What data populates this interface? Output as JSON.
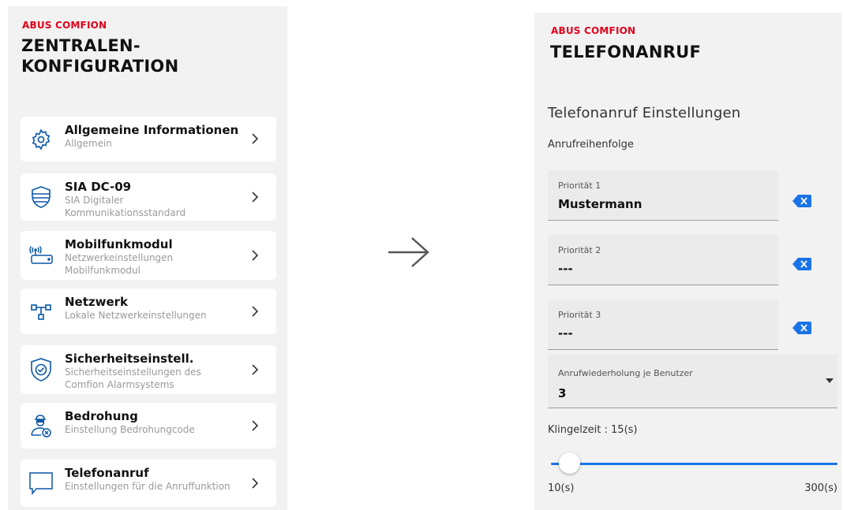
{
  "left_screen": {
    "brand": "ABUS COMFION",
    "title": "ZENTRALEN-\nKONFIGURATION",
    "items": [
      {
        "title": "Allgemeine Informationen",
        "subtitle": "Allgemein",
        "icon": "gear-icon"
      },
      {
        "title": "SIA DC-09",
        "subtitle": "SIA Digitaler Kommunikationsstandard",
        "icon": "shield-icon"
      },
      {
        "title": "Mobilfunkmodul",
        "subtitle": "Netzwerkeinstellungen Mobilfunkmodul",
        "icon": "cellular-module-icon"
      },
      {
        "title": "Netzwerk",
        "subtitle": "Lokale Netzwerkeinstellungen",
        "icon": "network-icon"
      },
      {
        "title": "Sicherheitseinstell.",
        "subtitle": "Sicherheitseinstellungen des Comfion Alarmsystems",
        "icon": "shield-check-icon"
      },
      {
        "title": "Bedrohung",
        "subtitle": "Einstellung Bedrohungcode",
        "icon": "threat-user-icon"
      },
      {
        "title": "Telefonanruf",
        "subtitle": "Einstellungen für die Anruffunktion",
        "icon": "chat-bubble-icon"
      }
    ]
  },
  "arrow_icon": "arrow-right-icon",
  "right_screen": {
    "brand": "ABUS COMFION",
    "title": "TELEFONANRUF",
    "section_heading": "Telefonanruf Einstellungen",
    "subheading": "Anrufreihenfolge",
    "priorities": [
      {
        "label": "Priorität 1",
        "value": "Mustermann"
      },
      {
        "label": "Priorität 2",
        "value": "---"
      },
      {
        "label": "Priorität 3",
        "value": "---"
      }
    ],
    "repeat": {
      "label": "Anrufwiederholung je Benutzer",
      "value": "3"
    },
    "ring_label": "Klingelzeit : 15(s)",
    "slider": {
      "min_label": "10(s)",
      "max_label": "300(s)",
      "min": 10,
      "max": 300,
      "value": 15
    },
    "colors": {
      "brand": "#e2001a",
      "accent": "#1a73e8",
      "icon_blue": "#0a57a8"
    }
  }
}
